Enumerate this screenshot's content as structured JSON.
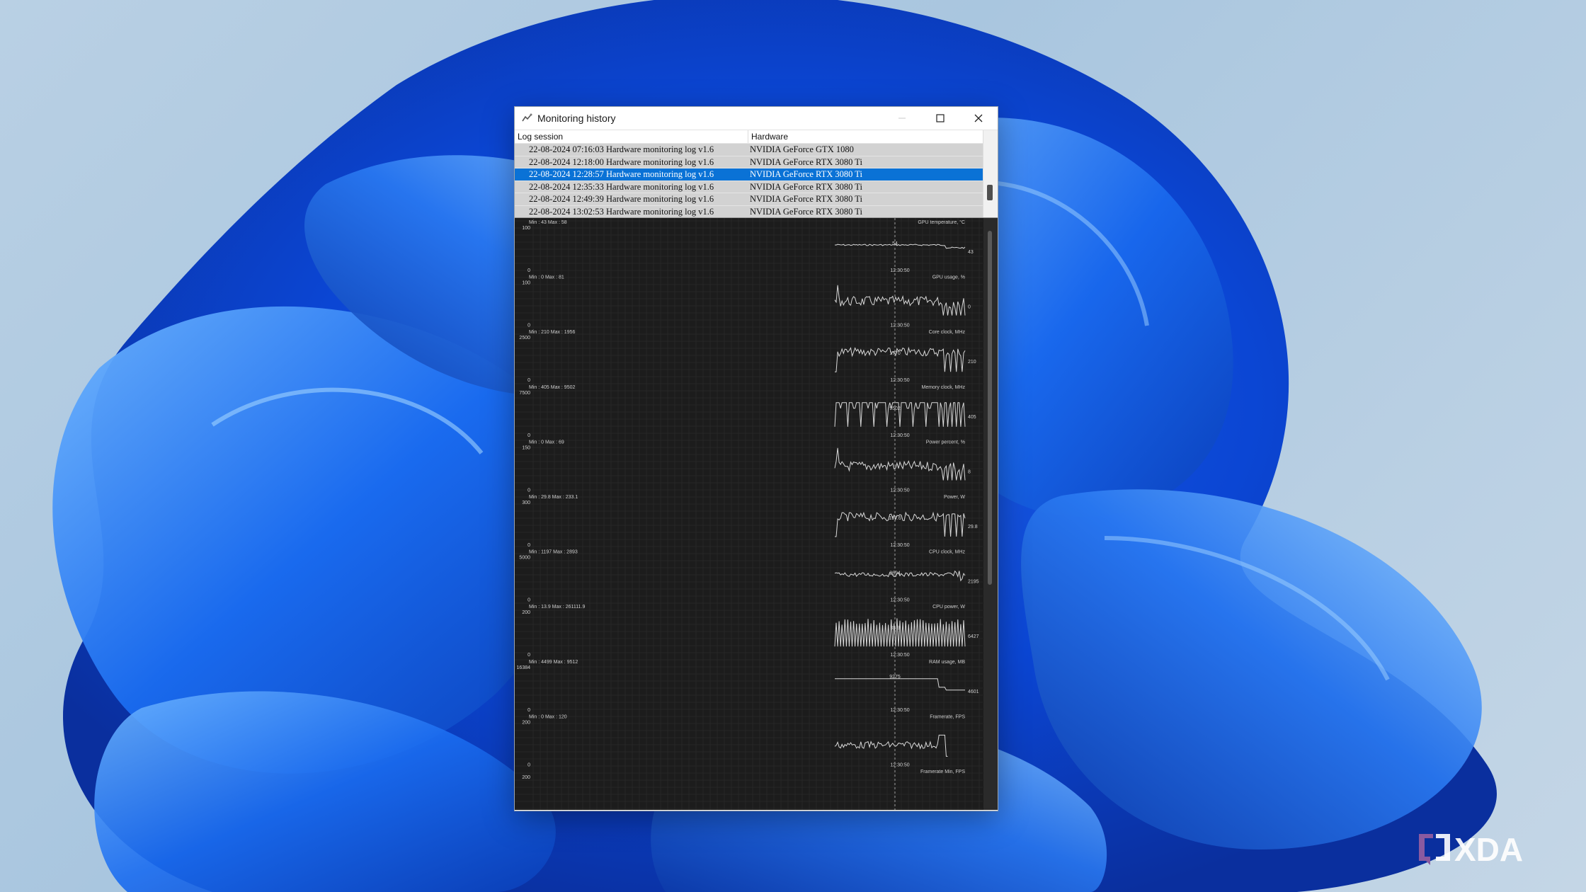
{
  "window": {
    "title": "Monitoring history",
    "icon": "monitoring-app-icon",
    "controls": [
      "minimize-icon",
      "maximize-icon",
      "close-icon"
    ]
  },
  "log_list": {
    "columns": [
      "Log session",
      "Hardware"
    ],
    "rows": [
      {
        "session": "22-08-2024 07:16:03 Hardware monitoring log v1.6",
        "hardware": "NVIDIA GeForce GTX 1080",
        "selected": false
      },
      {
        "session": "22-08-2024 12:18:00 Hardware monitoring log v1.6",
        "hardware": "NVIDIA GeForce RTX 3080 Ti",
        "selected": false
      },
      {
        "session": "22-08-2024 12:28:57 Hardware monitoring log v1.6",
        "hardware": "NVIDIA GeForce RTX 3080 Ti",
        "selected": true
      },
      {
        "session": "22-08-2024 12:35:33 Hardware monitoring log v1.6",
        "hardware": "NVIDIA GeForce RTX 3080 Ti",
        "selected": false
      },
      {
        "session": "22-08-2024 12:49:39 Hardware monitoring log v1.6",
        "hardware": "NVIDIA GeForce RTX 3080 Ti",
        "selected": false
      },
      {
        "session": "22-08-2024 13:02:53 Hardware monitoring log v1.6",
        "hardware": "NVIDIA GeForce RTX 3080 Ti",
        "selected": false
      }
    ]
  },
  "graphs": [
    {
      "name": "GPU temperature, °C",
      "minmax": "Min : 43  Max : 58",
      "ymax": "100",
      "ymin": "0",
      "time": "12:30:50",
      "cursor_value": "54",
      "current_value": "43",
      "style": "flat"
    },
    {
      "name": "GPU usage, %",
      "minmax": "Min : 0  Max : 81",
      "ymax": "100",
      "ymin": "0",
      "time": "12:30:50",
      "cursor_value": "",
      "current_value": "0",
      "style": "noisy"
    },
    {
      "name": "Core clock, MHz",
      "minmax": "Min : 210  Max : 1956",
      "ymax": "2500",
      "ymin": "0",
      "time": "12:30:50",
      "cursor_value": "1770",
      "current_value": "210",
      "style": "clock"
    },
    {
      "name": "Memory clock, MHz",
      "minmax": "Min : 405  Max : 9502",
      "ymax": "7500",
      "ymin": "0",
      "time": "12:30:50",
      "cursor_value": "9502",
      "current_value": "405",
      "style": "square"
    },
    {
      "name": "Power percent, %",
      "minmax": "Min : 0  Max : 69",
      "ymax": "150",
      "ymin": "0",
      "time": "12:30:50",
      "cursor_value": "",
      "current_value": "8",
      "style": "noisy"
    },
    {
      "name": "Power, W",
      "minmax": "Min : 29.8  Max : 233.1",
      "ymax": "300",
      "ymin": "0",
      "time": "12:30:50",
      "cursor_value": "157.6",
      "current_value": "29.8",
      "style": "clock"
    },
    {
      "name": "CPU clock, MHz",
      "minmax": "Min : 1197  Max : 2893",
      "ymax": "5000",
      "ymin": "0",
      "time": "12:30:50",
      "cursor_value": "2694",
      "current_value": "2195",
      "style": "cpu"
    },
    {
      "name": "CPU power, W",
      "minmax": "Min : 13.9  Max : 261111.9",
      "ymax": "200",
      "ymin": "0",
      "time": "12:30:50",
      "cursor_value": "35.9",
      "current_value": "6427",
      "style": "bars"
    },
    {
      "name": "RAM usage, MB",
      "minmax": "Min : 4499  Max : 9512",
      "ymax": "16384",
      "ymin": "0",
      "time": "12:30:50",
      "cursor_value": "9275",
      "current_value": "4601",
      "style": "ram"
    },
    {
      "name": "Framerate, FPS",
      "minmax": "Min : 0  Max : 120",
      "ymax": "200",
      "ymin": "0",
      "time": "12:30:50",
      "cursor_value": "",
      "current_value": "",
      "style": "fps"
    },
    {
      "name": "Framerate Min, FPS",
      "minmax": "",
      "ymax": "200",
      "ymin": "",
      "time": "",
      "cursor_value": "",
      "current_value": "",
      "style": "none"
    }
  ],
  "watermark": {
    "text": "XDA",
    "logo": "xda-logo-icon"
  },
  "colors": {
    "selection": "#0a72d6",
    "graph_bg": "#1c1c1c",
    "graph_line": "#d8d8d8"
  }
}
